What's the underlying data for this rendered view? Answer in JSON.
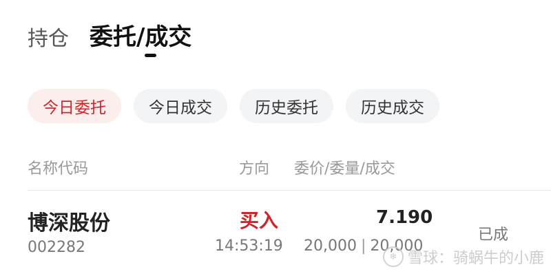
{
  "top_tabs": {
    "holdings": "持仓",
    "orders_trades": "委托/成交"
  },
  "filters": [
    {
      "label": "今日委托",
      "active": true
    },
    {
      "label": "今日成交",
      "active": false
    },
    {
      "label": "历史委托",
      "active": false
    },
    {
      "label": "历史成交",
      "active": false
    }
  ],
  "columns": {
    "name_code": "名称代码",
    "direction": "方向",
    "price_qty": "委价/委量/成交"
  },
  "orders": [
    {
      "name": "博深股份",
      "code": "002282",
      "direction": "买入",
      "time": "14:53:19",
      "price": "7.190",
      "order_qty": "20,000",
      "filled_qty": "20,000",
      "status": "已成"
    }
  ],
  "watermark": {
    "text": "雪球：骑蜗牛的小鹿"
  },
  "colors": {
    "accent_red": "#d0242b",
    "chip_active_bg": "#fdeeee",
    "chip_bg": "#f3f4f6"
  }
}
